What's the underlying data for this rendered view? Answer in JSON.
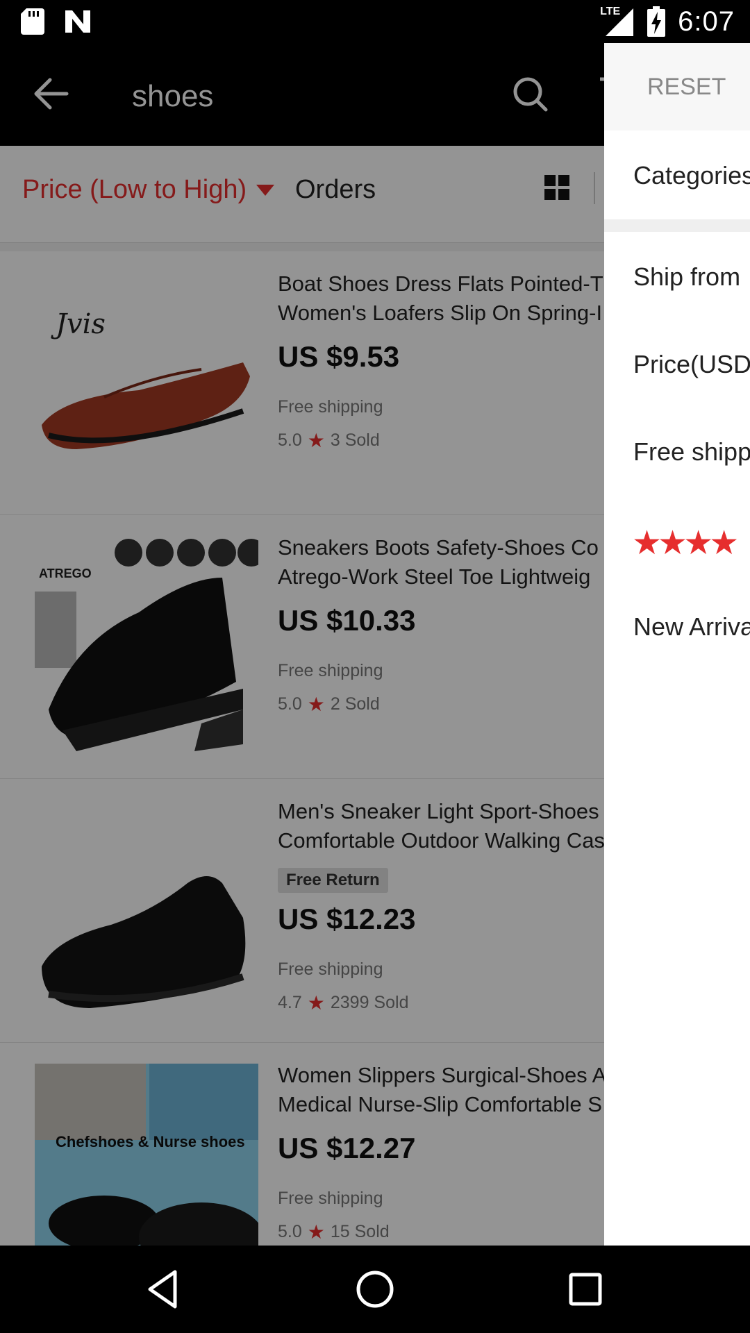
{
  "status_bar": {
    "time": "6:07",
    "network": "LTE"
  },
  "app_bar": {
    "query": "shoes"
  },
  "sort_bar": {
    "price_sort": "Price (Low to High)",
    "orders": "Orders"
  },
  "products": [
    {
      "title_line1": "Boat Shoes Dress Flats Pointed-T",
      "title_line2": "Women's Loafers Slip On Spring-I",
      "badge": "",
      "price": "US $9.53",
      "shipping": "Free shipping",
      "rating": "5.0",
      "sold": "3 Sold"
    },
    {
      "title_line1": "Sneakers Boots Safety-Shoes Co",
      "title_line2": "Atrego-Work Steel Toe Lightweig",
      "badge": "",
      "price": "US $10.33",
      "shipping": "Free shipping",
      "rating": "5.0",
      "sold": "2 Sold"
    },
    {
      "title_line1": "Men's Sneaker Light Sport-Shoes",
      "title_line2": "Comfortable Outdoor Walking Cas",
      "badge": "Free Return",
      "price": "US $12.23",
      "shipping": "Free shipping",
      "rating": "4.7",
      "sold": "2399 Sold"
    },
    {
      "title_line1": "Women Slippers Surgical-Shoes A",
      "title_line2": "Medical Nurse-Slip Comfortable S",
      "badge": "",
      "price": "US $12.27",
      "shipping": "Free shipping",
      "rating": "5.0",
      "sold": "15 Sold"
    }
  ],
  "product_image_texts": {
    "logo_1": "Jvis",
    "brand_2": "ATREGO",
    "banner_4": "Chefshoes & Nurse shoes"
  },
  "drawer": {
    "reset": "RESET",
    "categories": "Categories",
    "ship_from": "Ship from",
    "price": "Price(USD",
    "free_shipping": "Free shipp",
    "stars": "★★★★",
    "new_arrivals": "New Arriva"
  },
  "colors": {
    "accent": "#e62e2e",
    "dim_overlay": "rgba(0,0,0,0.42)"
  }
}
